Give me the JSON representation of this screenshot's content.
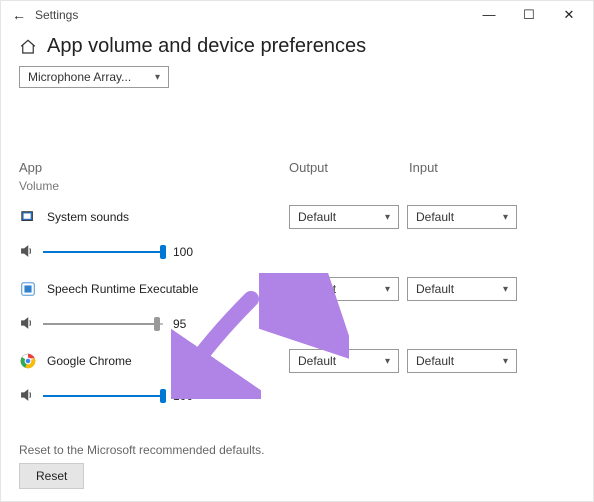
{
  "window": {
    "app_name": "Settings",
    "page_title": "App volume and device preferences"
  },
  "top_combo": "Microphone Array...",
  "columns": {
    "app": "App",
    "output": "Output",
    "input": "Input"
  },
  "volume_label": "Volume",
  "apps": [
    {
      "name": "System sounds",
      "volume": 100,
      "output": "Default",
      "input": "Default",
      "fill_color": "blue"
    },
    {
      "name": "Speech Runtime Executable",
      "volume": 95,
      "output": "Default",
      "input": "Default",
      "fill_color": "gray"
    },
    {
      "name": "Google Chrome",
      "volume": 100,
      "output": "Default",
      "input": "Default",
      "fill_color": "blue"
    }
  ],
  "footer": {
    "text": "Reset to the Microsoft recommended defaults.",
    "button": "Reset"
  },
  "icons": {
    "back": "←",
    "minimize": "—",
    "maximize": "☐",
    "close": "✕"
  }
}
